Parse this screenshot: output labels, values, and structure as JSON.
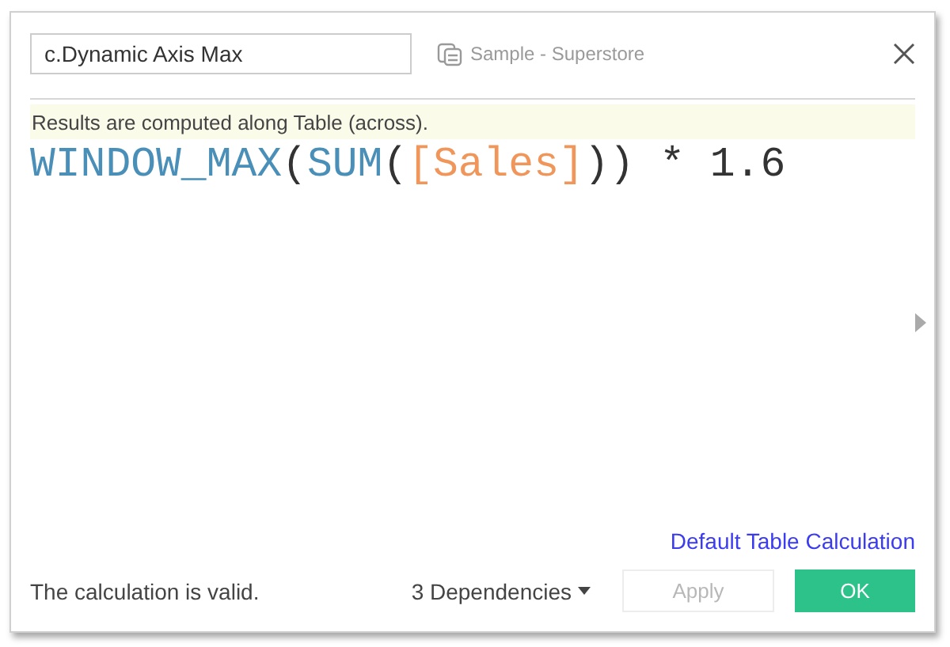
{
  "name_field": {
    "value": "c.Dynamic Axis Max"
  },
  "data_source": "Sample - Superstore",
  "info": "Results are computed along Table (across).",
  "formula": [
    {
      "kind": "function",
      "text": "WINDOW_MAX"
    },
    {
      "kind": "plain",
      "text": "("
    },
    {
      "kind": "function",
      "text": "SUM"
    },
    {
      "kind": "plain",
      "text": "("
    },
    {
      "kind": "field",
      "text": "[Sales]"
    },
    {
      "kind": "plain",
      "text": ")) * 1.6"
    }
  ],
  "link": "Default Table Calculation",
  "status": "The calculation is valid.",
  "dependencies": "3 Dependencies",
  "buttons": [
    {
      "label": "Apply",
      "disabled": true,
      "primary": false
    },
    {
      "label": "OK",
      "disabled": false,
      "primary": true
    }
  ]
}
